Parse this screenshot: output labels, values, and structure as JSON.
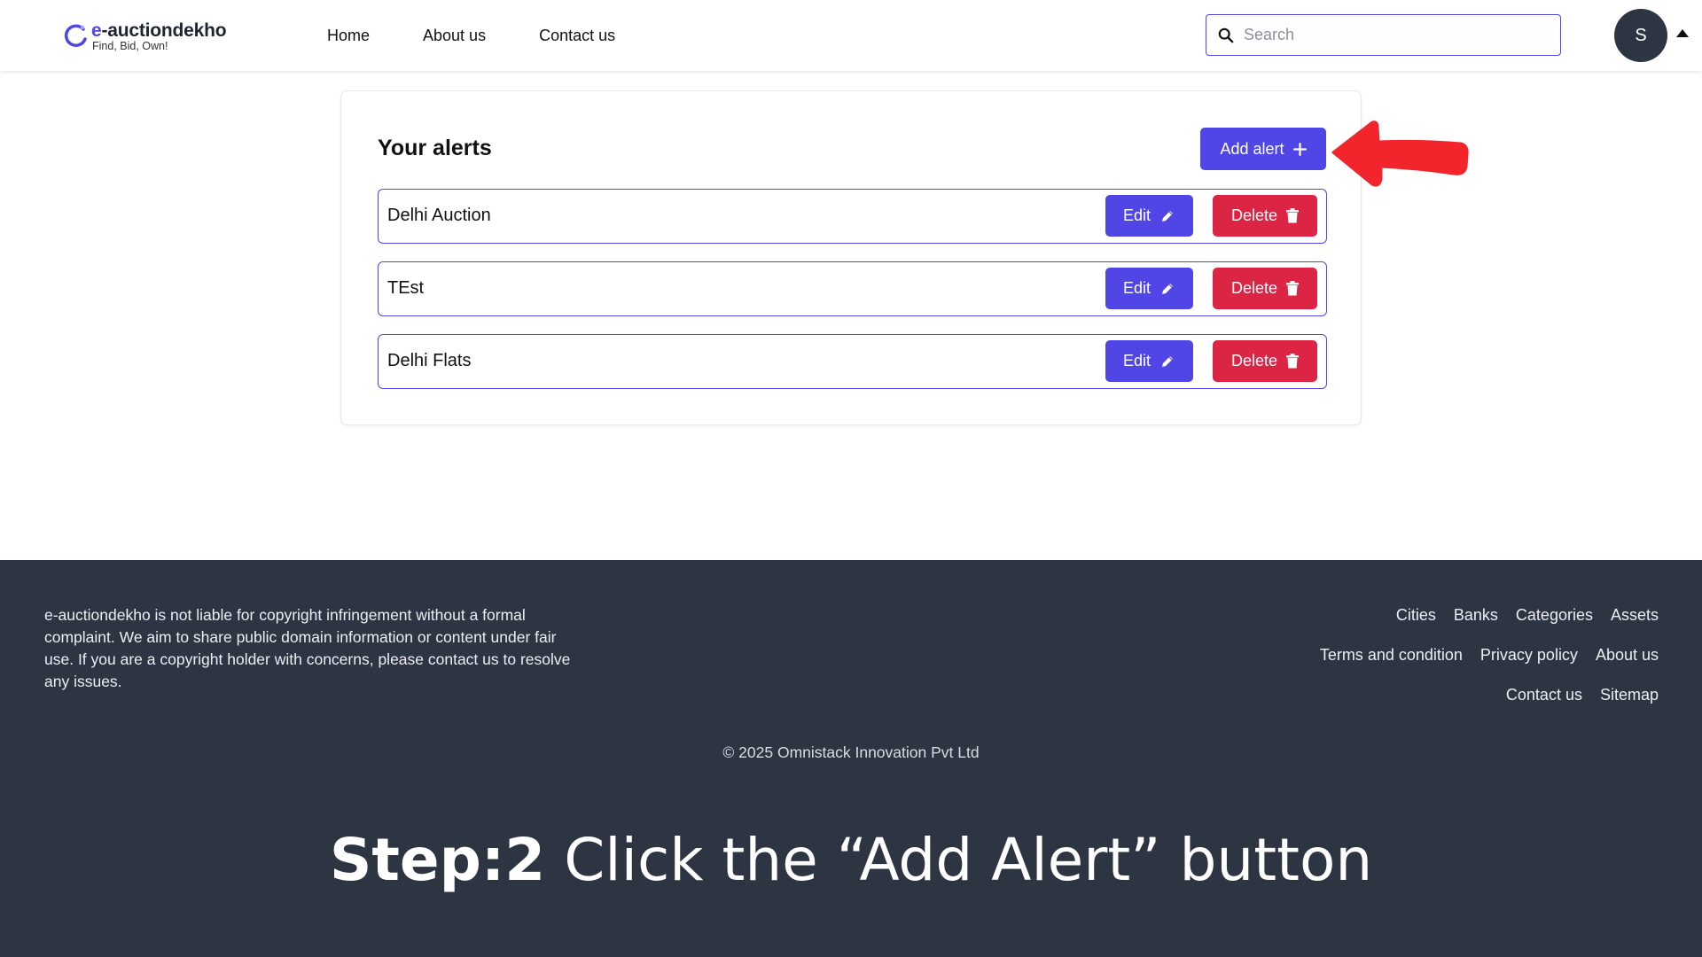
{
  "header": {
    "logo_name": "e-auctiondekho",
    "logo_tagline": "Find, Bid, Own!",
    "nav": [
      "Home",
      "About us",
      "Contact us"
    ],
    "search_placeholder": "Search",
    "avatar_initial": "S"
  },
  "alerts_card": {
    "title": "Your alerts",
    "add_label": "Add alert",
    "edit_label": "Edit",
    "delete_label": "Delete",
    "alerts": [
      "Delhi Auction",
      "TEst",
      "Delhi Flats"
    ]
  },
  "footer": {
    "disclaimer": "e-auctiondekho is not liable for copyright infringement without a formal complaint. We aim to share public domain information or content under fair use. If you are a copyright holder with concerns, please contact us to resolve any issues.",
    "links_row1": [
      "Cities",
      "Banks",
      "Categories",
      "Assets"
    ],
    "links_row2": [
      "Terms and condition",
      "Privacy policy",
      "About us"
    ],
    "links_row3": [
      "Contact us",
      "Sitemap"
    ],
    "copyright": "© 2025 Omnistack Innovation Pvt Ltd"
  },
  "caption": {
    "step": "Step:2",
    "text": "Click the “Add Alert” button"
  },
  "colors": {
    "brand": "#4f46e5",
    "danger": "#dc2545",
    "footer_bg": "#2d3442",
    "annotation_arrow": "#f2242c"
  }
}
